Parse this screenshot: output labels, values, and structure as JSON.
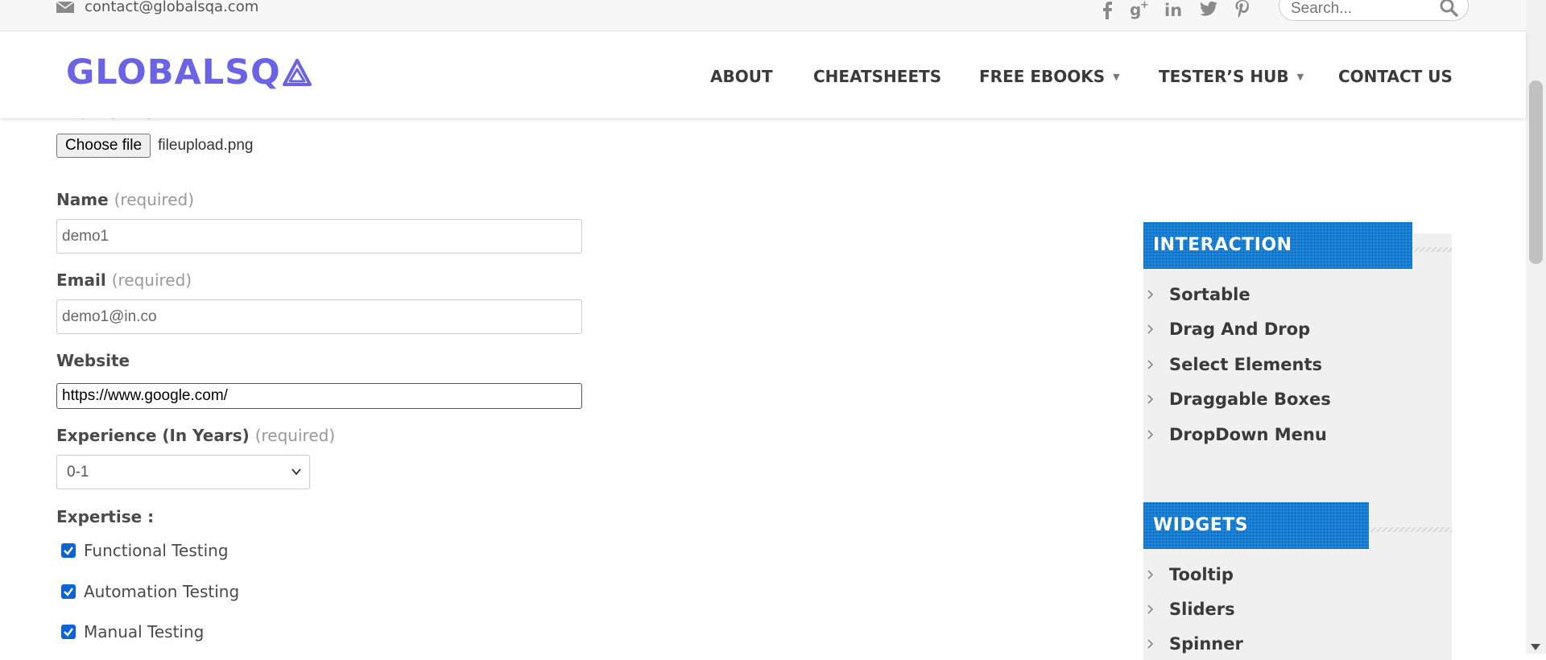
{
  "topbar": {
    "email": "contact@globalsqa.com",
    "social_icons": [
      "facebook-icon",
      "google-plus-icon",
      "linkedin-icon",
      "twitter-icon",
      "pinterest-icon"
    ],
    "search_placeholder": "Search..."
  },
  "header": {
    "logo_text": "GLOBALSQ",
    "nav": [
      {
        "label": "ABOUT",
        "has_dropdown": false
      },
      {
        "label": "CHEATSHEETS",
        "has_dropdown": false
      },
      {
        "label": "FREE EBOOKS",
        "has_dropdown": true
      },
      {
        "label": "TESTER’S HUB",
        "has_dropdown": true
      },
      {
        "label": "CONTACT US",
        "has_dropdown": false
      }
    ]
  },
  "form": {
    "profile_label": "Profile Pic",
    "file_button": "Choose file",
    "file_name": "fileupload.png",
    "name": {
      "label": "Name",
      "required": "(required)",
      "value": "demo1"
    },
    "email": {
      "label": "Email",
      "required": "(required)",
      "value": "demo1@in.co"
    },
    "website": {
      "label": "Website",
      "value": "https://www.google.com/"
    },
    "experience": {
      "label": "Experience (In Years)",
      "required": "(required)",
      "value": "0-1"
    },
    "expertise": {
      "label": "Expertise :",
      "options": [
        {
          "label": "Functional Testing",
          "checked": true
        },
        {
          "label": "Automation Testing",
          "checked": true
        },
        {
          "label": "Manual Testing",
          "checked": true
        }
      ]
    }
  },
  "sidebar": {
    "interaction": {
      "title": "INTERACTION",
      "items": [
        "Sortable",
        "Drag And Drop",
        "Select Elements",
        "Draggable Boxes",
        "DropDown Menu"
      ]
    },
    "widgets": {
      "title": "WIDGETS",
      "items": [
        "Tooltip",
        "Sliders",
        "Spinner"
      ]
    }
  },
  "colors": {
    "brand": "#6b63e6",
    "widget_header": "#1b87db",
    "checkbox": "#0b63d6"
  }
}
